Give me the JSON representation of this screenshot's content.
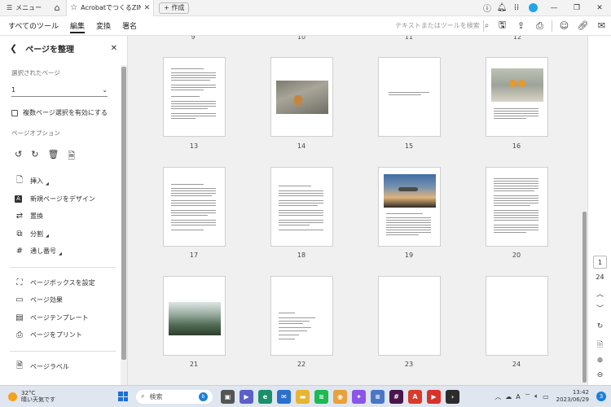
{
  "titlebar": {
    "menu_label": "メニュー",
    "tab_title": "AcrobatでつくるZINE.p...",
    "new_tab_label": "作成"
  },
  "menubar": {
    "items": [
      "すべてのツール",
      "編集",
      "変換",
      "署名"
    ],
    "active": "編集",
    "search_placeholder": "テキストまたはツールを検索"
  },
  "panel": {
    "title": "ページを整理",
    "selected_pages_label": "選択されたページ",
    "selected_pages_value": "1",
    "multi_select_label": "複数ページ選択を有効にする",
    "page_options_label": "ページオプション",
    "actions": [
      "挿入",
      "新規ページをデザイン",
      "置換",
      "分割",
      "通し番号"
    ],
    "actions2": [
      "ページボックスを設定",
      "ページ効果",
      "ページテンプレート",
      "ページをプリント"
    ],
    "actions3": [
      "ページラベル"
    ]
  },
  "pages": {
    "top_row_numbers": [
      "9",
      "10",
      "11",
      "12"
    ],
    "rows": [
      [
        "13",
        "14",
        "15",
        "16"
      ],
      [
        "17",
        "18",
        "19",
        "20"
      ],
      [
        "21",
        "22",
        "23",
        "24"
      ]
    ]
  },
  "rail": {
    "current_page": "1",
    "total_pages": "24"
  },
  "taskbar": {
    "temperature": "32°C",
    "weather": "晴い天気です",
    "search_label": "検索",
    "time": "13:42",
    "date": "2023/06/29",
    "notification_count": "3",
    "ime": "A"
  }
}
